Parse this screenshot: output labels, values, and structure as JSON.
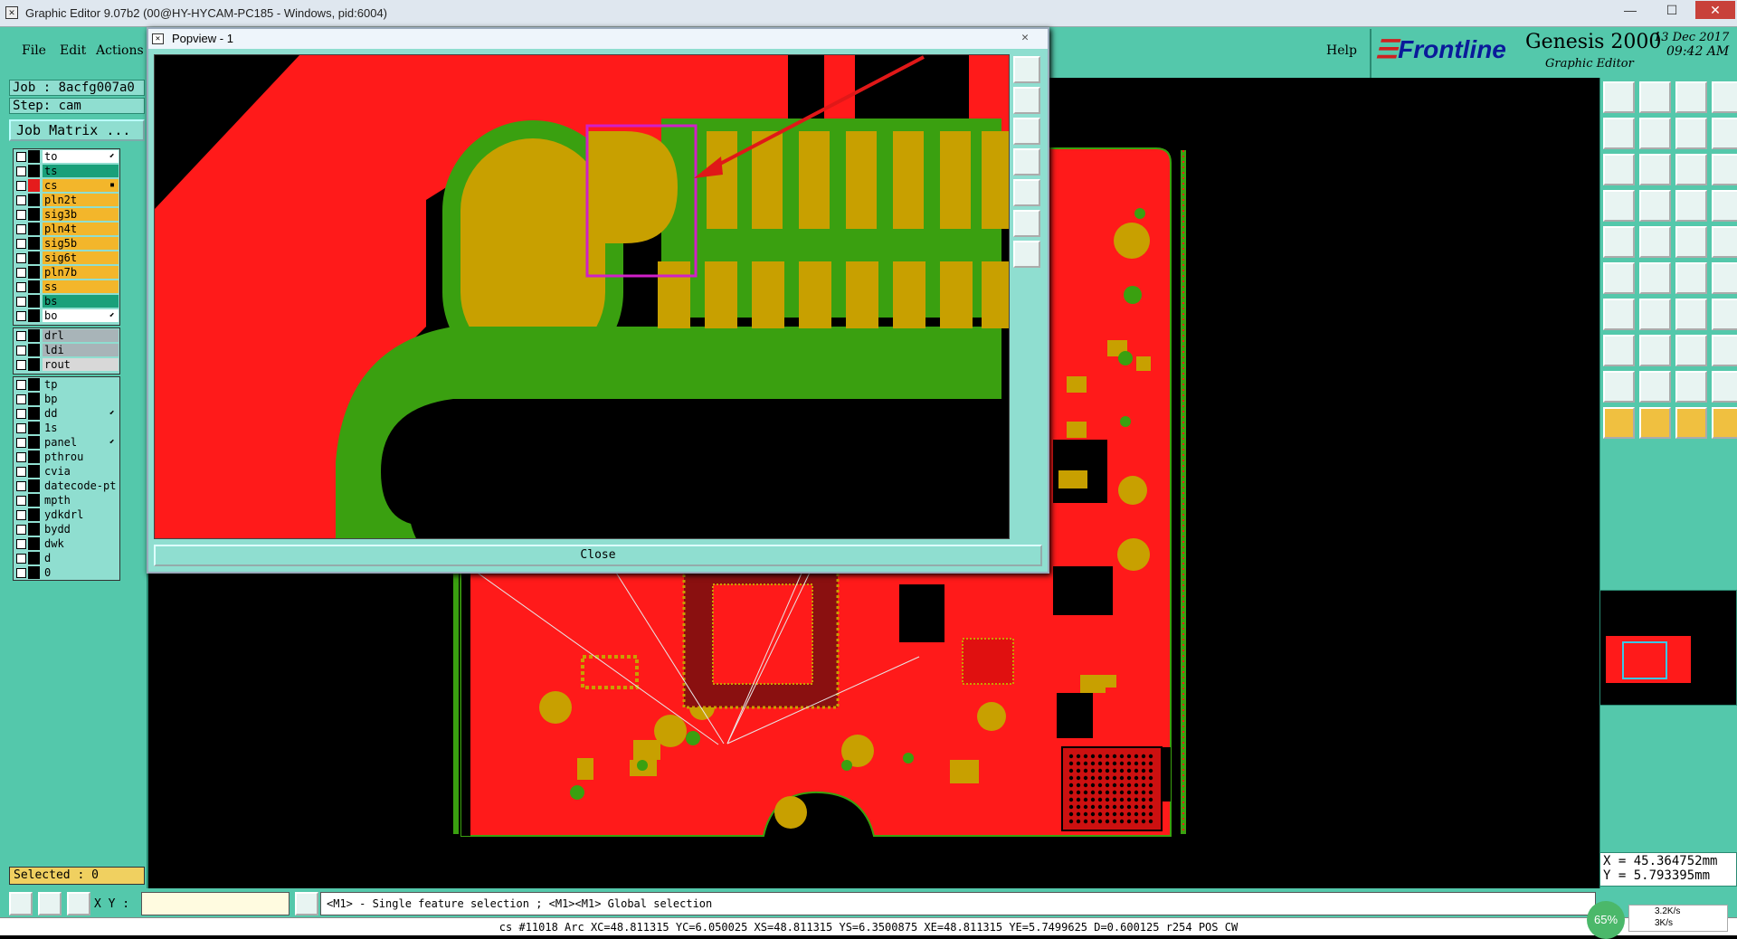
{
  "window": {
    "title": "Graphic Editor 9.07b2 (00@HY-HYCAM-PC185 - Windows, pid:6004)",
    "min_icon": "minimize-icon",
    "max_icon": "maximize-icon",
    "close_icon": "close-icon"
  },
  "menu": {
    "file": "File",
    "edit": "Edit",
    "actions": "Actions",
    "help": "Help"
  },
  "brand": {
    "logo": "Frontline",
    "product": "Genesis 2000",
    "subtitle": "Graphic Editor",
    "date": "13 Dec 2017",
    "time": "09:42 AM"
  },
  "job": {
    "job_line": "Job : 8acfg007a0",
    "step_line": "Step: cam",
    "matrix_button": "Job Matrix ..."
  },
  "layers_board": [
    {
      "name": "to",
      "color": "#ffffff",
      "swatch": "#000000",
      "marker": "⬋"
    },
    {
      "name": "ts",
      "color": "#19a07a",
      "swatch": "#000000",
      "marker": ""
    },
    {
      "name": "cs",
      "color": "#f3b62b",
      "swatch": "#e51c1c",
      "marker": "▪"
    },
    {
      "name": "pln2t",
      "color": "#f3b62b",
      "swatch": "#000000",
      "marker": ""
    },
    {
      "name": "sig3b",
      "color": "#f3b62b",
      "swatch": "#000000",
      "marker": ""
    },
    {
      "name": "pln4t",
      "color": "#f3b62b",
      "swatch": "#000000",
      "marker": ""
    },
    {
      "name": "sig5b",
      "color": "#f3b62b",
      "swatch": "#000000",
      "marker": ""
    },
    {
      "name": "sig6t",
      "color": "#f3b62b",
      "swatch": "#000000",
      "marker": ""
    },
    {
      "name": "pln7b",
      "color": "#f3b62b",
      "swatch": "#000000",
      "marker": ""
    },
    {
      "name": "ss",
      "color": "#f3b62b",
      "swatch": "#000000",
      "marker": ""
    },
    {
      "name": "bs",
      "color": "#19a07a",
      "swatch": "#000000",
      "marker": ""
    },
    {
      "name": "bo",
      "color": "#ffffff",
      "swatch": "#000000",
      "marker": "⬋"
    }
  ],
  "layers_drill": [
    {
      "name": "drl",
      "color": "#a8b4b8",
      "swatch": "#000000",
      "marker": ""
    },
    {
      "name": "ldi",
      "color": "#a8b4b8",
      "swatch": "#000000",
      "marker": ""
    },
    {
      "name": "rout",
      "color": "#d8d8d8",
      "swatch": "#000000",
      "marker": ""
    }
  ],
  "layers_misc": [
    {
      "name": "tp",
      "color": "#8fded0",
      "swatch": "#000000",
      "marker": ""
    },
    {
      "name": "bp",
      "color": "#8fded0",
      "swatch": "#000000",
      "marker": ""
    },
    {
      "name": "dd",
      "color": "#8fded0",
      "swatch": "#000000",
      "marker": "⬋"
    },
    {
      "name": "1s",
      "color": "#8fded0",
      "swatch": "#000000",
      "marker": ""
    },
    {
      "name": "panel",
      "color": "#8fded0",
      "swatch": "#000000",
      "marker": "⬋"
    },
    {
      "name": "pthrou",
      "color": "#8fded0",
      "swatch": "#000000",
      "marker": ""
    },
    {
      "name": "cvia",
      "color": "#8fded0",
      "swatch": "#000000",
      "marker": ""
    },
    {
      "name": "datecode-pt",
      "color": "#8fded0",
      "swatch": "#000000",
      "marker": ""
    },
    {
      "name": "mpth",
      "color": "#8fded0",
      "swatch": "#000000",
      "marker": ""
    },
    {
      "name": "ydkdrl",
      "color": "#8fded0",
      "swatch": "#000000",
      "marker": ""
    },
    {
      "name": "bydd",
      "color": "#8fded0",
      "swatch": "#000000",
      "marker": ""
    },
    {
      "name": "dwk",
      "color": "#8fded0",
      "swatch": "#000000",
      "marker": ""
    },
    {
      "name": "d",
      "color": "#8fded0",
      "swatch": "#000000",
      "marker": ""
    },
    {
      "name": "0",
      "color": "#8fded0",
      "swatch": "#000000",
      "marker": ""
    }
  ],
  "selected": "Selected : 0",
  "popview": {
    "title": "Popview - 1",
    "close_button": "Close"
  },
  "coords": {
    "x": "X = 45.364752mm",
    "y": "Y = 5.793395mm"
  },
  "bottom": {
    "xy_label": "X Y :",
    "xy_value": "",
    "message": "<M1> - Single feature selection ; <M1><M1> Global selection",
    "status": "cs #11018 Arc XC=48.811315 YC=6.050025 XS=48.811315 YS=6.3500875 XE=48.811315 YE=5.7499625 D=0.600125 r254 POS CW"
  },
  "net": {
    "percent": "65%",
    "up": "3.2K/s",
    "down": "3K/s"
  },
  "colors": {
    "panel": "#54c8ab",
    "copper": "#ff1a1a",
    "pad": "#c8a000",
    "mask": "#3aa010",
    "highlight": "#d020c8"
  }
}
